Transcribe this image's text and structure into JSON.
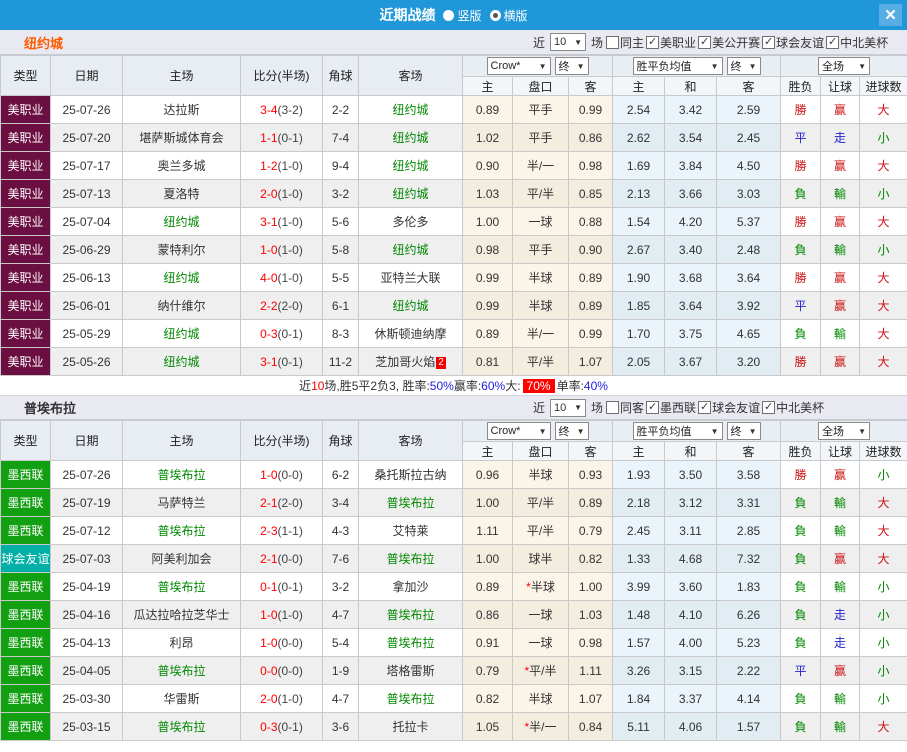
{
  "titlebar": {
    "title": "近期战绩",
    "radio_vertical": "竖版",
    "radio_horizontal": "横版",
    "close": "✕"
  },
  "filters_common": {
    "prefix": "近",
    "matches_value": "10",
    "suffix": "场"
  },
  "table_header": {
    "col_type": "类型",
    "col_date": "日期",
    "col_home": "主场",
    "col_score": "比分(半场)",
    "col_corner": "角球",
    "col_away": "客场",
    "dd_crow": "Crow*",
    "dd_final1": "终",
    "dd_mean": "胜平负均值",
    "dd_final2": "终",
    "dd_fullmatch": "全场",
    "sub_home": "主",
    "sub_handicap": "盘口",
    "sub_away": "客",
    "sub_mhome": "主",
    "sub_draw": "和",
    "sub_maway": "客",
    "sub_wdl": "胜负",
    "sub_handicap_res": "让球",
    "sub_goals": "进球数"
  },
  "type_colors": {
    "美职业": "#6b0e41",
    "墨西联": "#12a012",
    "球会友谊": "#00b0a6"
  },
  "colors": {
    "titlebar_blue": "#1f97d8",
    "close_btn_blue": "#58ade4",
    "team1_name": "#ff5a00",
    "team2_name": "#333333",
    "win_red": "#cc1111",
    "draw_blue": "#2222cc",
    "lose_green": "#008800",
    "score_red": "#fe0000",
    "highlight_red_bg": "#fe0000"
  },
  "teams": [
    {
      "name": "纽约城",
      "name_color": "#ff5a00",
      "filters": [
        {
          "label": "同主",
          "checked": false
        },
        {
          "label": "美职业",
          "checked": true
        },
        {
          "label": "美公开赛",
          "checked": true
        },
        {
          "label": "球会友谊",
          "checked": true
        },
        {
          "label": "中北美杯",
          "checked": true
        }
      ],
      "rows": [
        {
          "type": "美职业",
          "date": "25-07-26",
          "home": "达拉斯",
          "home_self": false,
          "score": "3-4",
          "half": "(3-2)",
          "corner": "2-2",
          "away": "纽约城",
          "away_self": true,
          "badge": "",
          "odds": [
            "0.89",
            "平手",
            "0.99"
          ],
          "star": false,
          "mean": [
            "2.54",
            "3.42",
            "2.59"
          ],
          "res": [
            [
              "勝",
              "red"
            ],
            [
              "赢",
              "red"
            ],
            [
              "大",
              "red"
            ]
          ]
        },
        {
          "type": "美职业",
          "date": "25-07-20",
          "home": "堪萨斯城体育会",
          "home_self": false,
          "score": "1-1",
          "half": "(0-1)",
          "corner": "7-4",
          "away": "纽约城",
          "away_self": true,
          "badge": "",
          "odds": [
            "1.02",
            "平手",
            "0.86"
          ],
          "star": false,
          "mean": [
            "2.62",
            "3.54",
            "2.45"
          ],
          "res": [
            [
              "平",
              "blue"
            ],
            [
              "走",
              "blue"
            ],
            [
              "小",
              "green"
            ]
          ]
        },
        {
          "type": "美职业",
          "date": "25-07-17",
          "home": "奥兰多城",
          "home_self": false,
          "score": "1-2",
          "half": "(1-0)",
          "corner": "9-4",
          "away": "纽约城",
          "away_self": true,
          "badge": "",
          "odds": [
            "0.90",
            "半/一",
            "0.98"
          ],
          "star": false,
          "mean": [
            "1.69",
            "3.84",
            "4.50"
          ],
          "res": [
            [
              "勝",
              "red"
            ],
            [
              "赢",
              "red"
            ],
            [
              "大",
              "red"
            ]
          ]
        },
        {
          "type": "美职业",
          "date": "25-07-13",
          "home": "夏洛特",
          "home_self": false,
          "score": "2-0",
          "half": "(1-0)",
          "corner": "3-2",
          "away": "纽约城",
          "away_self": true,
          "badge": "",
          "odds": [
            "1.03",
            "平/半",
            "0.85"
          ],
          "star": false,
          "mean": [
            "2.13",
            "3.66",
            "3.03"
          ],
          "res": [
            [
              "負",
              "green"
            ],
            [
              "輸",
              "green"
            ],
            [
              "小",
              "green"
            ]
          ]
        },
        {
          "type": "美职业",
          "date": "25-07-04",
          "home": "纽约城",
          "home_self": true,
          "score": "3-1",
          "half": "(1-0)",
          "corner": "5-6",
          "away": "多伦多",
          "away_self": false,
          "badge": "",
          "odds": [
            "1.00",
            "一球",
            "0.88"
          ],
          "star": false,
          "mean": [
            "1.54",
            "4.20",
            "5.37"
          ],
          "res": [
            [
              "勝",
              "red"
            ],
            [
              "赢",
              "red"
            ],
            [
              "大",
              "red"
            ]
          ]
        },
        {
          "type": "美职业",
          "date": "25-06-29",
          "home": "蒙特利尔",
          "home_self": false,
          "score": "1-0",
          "half": "(1-0)",
          "corner": "5-8",
          "away": "纽约城",
          "away_self": true,
          "badge": "",
          "odds": [
            "0.98",
            "平手",
            "0.90"
          ],
          "star": false,
          "mean": [
            "2.67",
            "3.40",
            "2.48"
          ],
          "res": [
            [
              "負",
              "green"
            ],
            [
              "輸",
              "green"
            ],
            [
              "小",
              "green"
            ]
          ]
        },
        {
          "type": "美职业",
          "date": "25-06-13",
          "home": "纽约城",
          "home_self": true,
          "score": "4-0",
          "half": "(1-0)",
          "corner": "5-5",
          "away": "亚特兰大联",
          "away_self": false,
          "badge": "",
          "odds": [
            "0.99",
            "半球",
            "0.89"
          ],
          "star": false,
          "mean": [
            "1.90",
            "3.68",
            "3.64"
          ],
          "res": [
            [
              "勝",
              "red"
            ],
            [
              "赢",
              "red"
            ],
            [
              "大",
              "red"
            ]
          ]
        },
        {
          "type": "美职业",
          "date": "25-06-01",
          "home": "纳什维尔",
          "home_self": false,
          "score": "2-2",
          "half": "(2-0)",
          "corner": "6-1",
          "away": "纽约城",
          "away_self": true,
          "badge": "",
          "odds": [
            "0.99",
            "半球",
            "0.89"
          ],
          "star": false,
          "mean": [
            "1.85",
            "3.64",
            "3.92"
          ],
          "res": [
            [
              "平",
              "blue"
            ],
            [
              "赢",
              "red"
            ],
            [
              "大",
              "red"
            ]
          ]
        },
        {
          "type": "美职业",
          "date": "25-05-29",
          "home": "纽约城",
          "home_self": true,
          "score": "0-3",
          "half": "(0-1)",
          "corner": "8-3",
          "away": "休斯顿迪纳摩",
          "away_self": false,
          "badge": "",
          "odds": [
            "0.89",
            "半/一",
            "0.99"
          ],
          "star": false,
          "mean": [
            "1.70",
            "3.75",
            "4.65"
          ],
          "res": [
            [
              "負",
              "green"
            ],
            [
              "輸",
              "green"
            ],
            [
              "大",
              "red"
            ]
          ]
        },
        {
          "type": "美职业",
          "date": "25-05-26",
          "home": "纽约城",
          "home_self": true,
          "score": "3-1",
          "half": "(0-1)",
          "corner": "11-2",
          "away": "芝加哥火焰",
          "away_self": false,
          "badge": "2",
          "odds": [
            "0.81",
            "平/半",
            "1.07"
          ],
          "star": false,
          "mean": [
            "2.05",
            "3.67",
            "3.20"
          ],
          "res": [
            [
              "勝",
              "red"
            ],
            [
              "赢",
              "red"
            ],
            [
              "大",
              "red"
            ]
          ]
        }
      ],
      "summary": [
        {
          "text": "近",
          "cls": "plain"
        },
        {
          "text": "10",
          "cls": "red"
        },
        {
          "text": "场,胜5平2负3, 胜率:",
          "cls": "plain"
        },
        {
          "text": "50%",
          "cls": "blue"
        },
        {
          "text": " 赢率:",
          "cls": "plain"
        },
        {
          "text": "60%",
          "cls": "blue"
        },
        {
          "text": " 大:",
          "cls": "plain"
        },
        {
          "text": "70%",
          "cls": "redbg"
        },
        {
          "text": " 单率:",
          "cls": "plain"
        },
        {
          "text": "40%",
          "cls": "blue"
        }
      ]
    },
    {
      "name": "普埃布拉",
      "name_color": "#333333",
      "filters": [
        {
          "label": "同客",
          "checked": false
        },
        {
          "label": "墨西联",
          "checked": true
        },
        {
          "label": "球会友谊",
          "checked": true
        },
        {
          "label": "中北美杯",
          "checked": true
        }
      ],
      "rows": [
        {
          "type": "墨西联",
          "date": "25-07-26",
          "home": "普埃布拉",
          "home_self": true,
          "score": "1-0",
          "half": "(0-0)",
          "corner": "6-2",
          "away": "桑托斯拉古纳",
          "away_self": false,
          "badge": "",
          "odds": [
            "0.96",
            "半球",
            "0.93"
          ],
          "star": false,
          "mean": [
            "1.93",
            "3.50",
            "3.58"
          ],
          "res": [
            [
              "勝",
              "red"
            ],
            [
              "赢",
              "red"
            ],
            [
              "小",
              "green"
            ]
          ]
        },
        {
          "type": "墨西联",
          "date": "25-07-19",
          "home": "马萨特兰",
          "home_self": false,
          "score": "2-1",
          "half": "(2-0)",
          "corner": "3-4",
          "away": "普埃布拉",
          "away_self": true,
          "badge": "",
          "odds": [
            "1.00",
            "平/半",
            "0.89"
          ],
          "star": false,
          "mean": [
            "2.18",
            "3.12",
            "3.31"
          ],
          "res": [
            [
              "負",
              "green"
            ],
            [
              "輸",
              "green"
            ],
            [
              "大",
              "red"
            ]
          ]
        },
        {
          "type": "墨西联",
          "date": "25-07-12",
          "home": "普埃布拉",
          "home_self": true,
          "score": "2-3",
          "half": "(1-1)",
          "corner": "4-3",
          "away": "艾特莱",
          "away_self": false,
          "badge": "",
          "odds": [
            "1.11",
            "平/半",
            "0.79"
          ],
          "star": false,
          "mean": [
            "2.45",
            "3.11",
            "2.85"
          ],
          "res": [
            [
              "負",
              "green"
            ],
            [
              "輸",
              "green"
            ],
            [
              "大",
              "red"
            ]
          ]
        },
        {
          "type": "球会友谊",
          "date": "25-07-03",
          "home": "阿美利加会",
          "home_self": false,
          "score": "2-1",
          "half": "(0-0)",
          "corner": "7-6",
          "away": "普埃布拉",
          "away_self": true,
          "badge": "",
          "odds": [
            "1.00",
            "球半",
            "0.82"
          ],
          "star": false,
          "mean": [
            "1.33",
            "4.68",
            "7.32"
          ],
          "res": [
            [
              "負",
              "green"
            ],
            [
              "赢",
              "red"
            ],
            [
              "大",
              "red"
            ]
          ]
        },
        {
          "type": "墨西联",
          "date": "25-04-19",
          "home": "普埃布拉",
          "home_self": true,
          "score": "0-1",
          "half": "(0-1)",
          "corner": "3-2",
          "away": "拿加沙",
          "away_self": false,
          "badge": "",
          "odds": [
            "0.89",
            "半球",
            "1.00"
          ],
          "star": true,
          "mean": [
            "3.99",
            "3.60",
            "1.83"
          ],
          "res": [
            [
              "負",
              "green"
            ],
            [
              "輸",
              "green"
            ],
            [
              "小",
              "green"
            ]
          ]
        },
        {
          "type": "墨西联",
          "date": "25-04-16",
          "home": "瓜达拉哈拉芝华士",
          "home_self": false,
          "score": "1-0",
          "half": "(1-0)",
          "corner": "4-7",
          "away": "普埃布拉",
          "away_self": true,
          "badge": "",
          "odds": [
            "0.86",
            "一球",
            "1.03"
          ],
          "star": false,
          "mean": [
            "1.48",
            "4.10",
            "6.26"
          ],
          "res": [
            [
              "負",
              "green"
            ],
            [
              "走",
              "blue"
            ],
            [
              "小",
              "green"
            ]
          ]
        },
        {
          "type": "墨西联",
          "date": "25-04-13",
          "home": "利昂",
          "home_self": false,
          "score": "1-0",
          "half": "(0-0)",
          "corner": "5-4",
          "away": "普埃布拉",
          "away_self": true,
          "badge": "",
          "odds": [
            "0.91",
            "一球",
            "0.98"
          ],
          "star": false,
          "mean": [
            "1.57",
            "4.00",
            "5.23"
          ],
          "res": [
            [
              "負",
              "green"
            ],
            [
              "走",
              "blue"
            ],
            [
              "小",
              "green"
            ]
          ]
        },
        {
          "type": "墨西联",
          "date": "25-04-05",
          "home": "普埃布拉",
          "home_self": true,
          "score": "0-0",
          "half": "(0-0)",
          "corner": "1-9",
          "away": "塔格雷斯",
          "away_self": false,
          "badge": "",
          "odds": [
            "0.79",
            "平/半",
            "1.11"
          ],
          "star": true,
          "mean": [
            "3.26",
            "3.15",
            "2.22"
          ],
          "res": [
            [
              "平",
              "blue"
            ],
            [
              "赢",
              "red"
            ],
            [
              "小",
              "green"
            ]
          ]
        },
        {
          "type": "墨西联",
          "date": "25-03-30",
          "home": "华雷斯",
          "home_self": false,
          "score": "2-0",
          "half": "(1-0)",
          "corner": "4-7",
          "away": "普埃布拉",
          "away_self": true,
          "badge": "",
          "odds": [
            "0.82",
            "半球",
            "1.07"
          ],
          "star": false,
          "mean": [
            "1.84",
            "3.37",
            "4.14"
          ],
          "res": [
            [
              "負",
              "green"
            ],
            [
              "輸",
              "green"
            ],
            [
              "小",
              "green"
            ]
          ]
        },
        {
          "type": "墨西联",
          "date": "25-03-15",
          "home": "普埃布拉",
          "home_self": true,
          "score": "0-3",
          "half": "(0-1)",
          "corner": "3-6",
          "away": "托拉卡",
          "away_self": false,
          "badge": "",
          "odds": [
            "1.05",
            "半/一",
            "0.84"
          ],
          "star": true,
          "mean": [
            "5.11",
            "4.06",
            "1.57"
          ],
          "res": [
            [
              "負",
              "green"
            ],
            [
              "輸",
              "green"
            ],
            [
              "大",
              "red"
            ]
          ]
        }
      ],
      "summary": []
    }
  ]
}
